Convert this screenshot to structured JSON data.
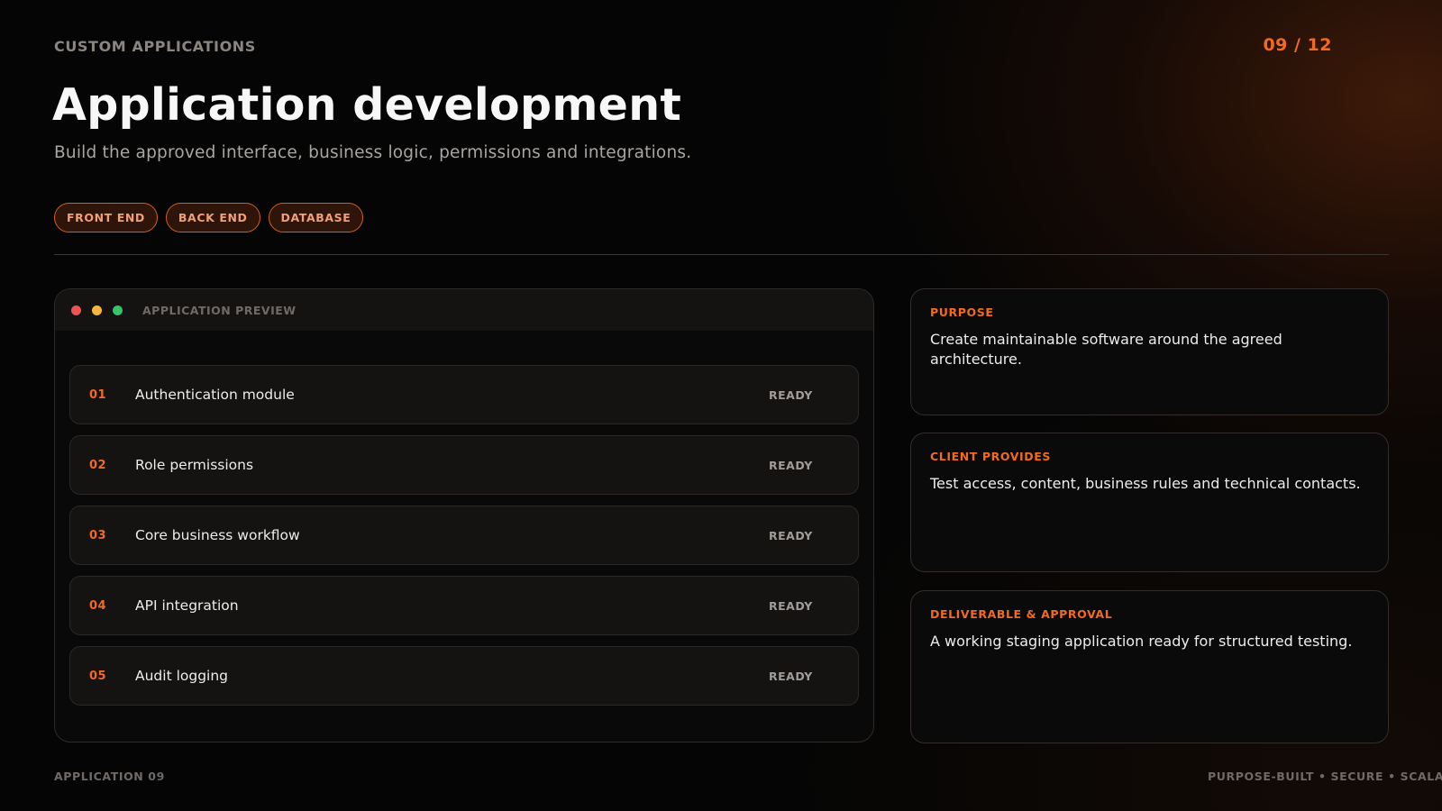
{
  "header": {
    "eyebrow": "CUSTOM APPLICATIONS",
    "page_counter": "09 / 12",
    "title": "Application development",
    "subtitle": "Build the approved interface, business logic, permissions and integrations."
  },
  "tags": [
    "FRONT END",
    "BACK END",
    "DATABASE"
  ],
  "preview": {
    "window_title": "APPLICATION PREVIEW",
    "window_controls": [
      "close-dot",
      "minimize-dot",
      "maximize-dot"
    ],
    "modules": [
      {
        "num": "01",
        "name": "Authentication module",
        "status": "READY"
      },
      {
        "num": "02",
        "name": "Role permissions",
        "status": "READY"
      },
      {
        "num": "03",
        "name": "Core business workflow",
        "status": "READY"
      },
      {
        "num": "04",
        "name": "API integration",
        "status": "READY"
      },
      {
        "num": "05",
        "name": "Audit logging",
        "status": "READY"
      }
    ]
  },
  "cards": [
    {
      "label": "PURPOSE",
      "text": "Create maintainable software around the agreed architecture."
    },
    {
      "label": "CLIENT PROVIDES",
      "text": "Test access, content, business rules and technical contacts."
    },
    {
      "label": "DELIVERABLE & APPROVAL",
      "text": "A working staging application ready for structured testing."
    }
  ],
  "footer": {
    "left": "APPLICATION 09",
    "right": "PURPOSE-BUILT • SECURE • SCALABLE"
  },
  "colors": {
    "accent": "#f36a1f",
    "background": "#050505",
    "dot_red": "#ef5350",
    "dot_yellow": "#f6b73c",
    "dot_green": "#34c46a"
  }
}
